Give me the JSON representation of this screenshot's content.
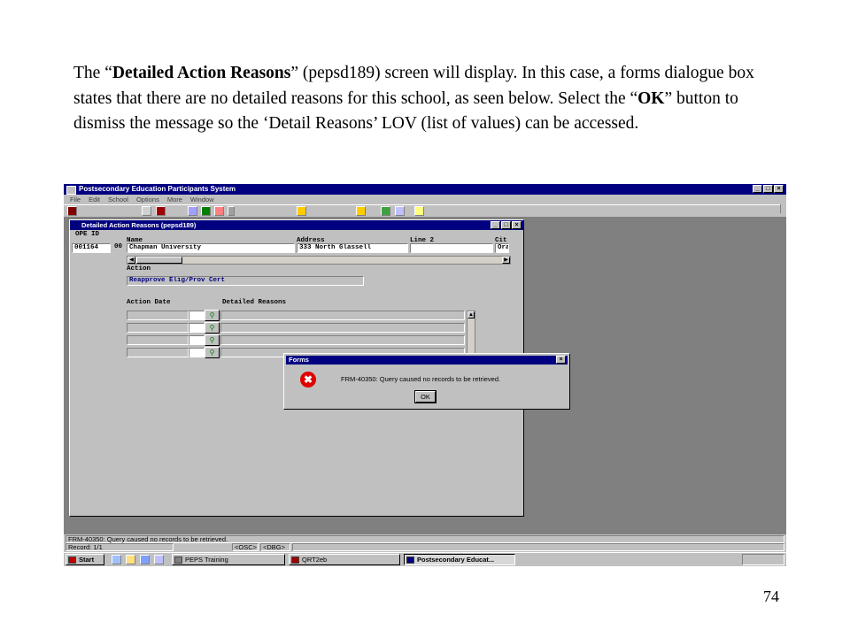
{
  "intro": {
    "t1": "The “",
    "t1_bold": "Detailed Action Reasons",
    "t2": "” (pepsd189) screen will display.  In this case, a forms dialogue box states that there are no detailed reasons for this school, as seen below.  Select the “",
    "t2_bold": "OK",
    "t3": "” button to dismiss the message so the ‘Detail Reasons’ LOV (list of values) can be accessed."
  },
  "page_number": "74",
  "app": {
    "title": "Postsecondary Education Participants System",
    "window_buttons": [
      "_",
      "□",
      "×"
    ],
    "menu": [
      "File",
      "Edit",
      "School",
      "Options",
      "More",
      "Window"
    ]
  },
  "form": {
    "title": "Detailed Action Reasons (pepsd189)",
    "labels": {
      "ope_id": "OPE ID",
      "name": "Name",
      "address": "Address",
      "line2": "Line 2",
      "city": "Cit",
      "action": "Action",
      "action_date": "Action Date",
      "detailed_reasons": "Detailed Reasons"
    },
    "values": {
      "ope_id": "001164",
      "ope_id_suffix": "00",
      "name": "Chapman University",
      "address": "333 North Glassell",
      "line2": "",
      "city": "Ora",
      "action": "Reapprove Elig/Prov Cert"
    },
    "lov_icon": "lov-lookup-icon"
  },
  "dialog": {
    "title": "Forms",
    "icon": "error-x-icon",
    "message": "FRM-40350: Query caused no records to be retrieved.",
    "ok_label": "OK"
  },
  "status": {
    "message": "FRM-40350: Query caused no records to be retrieved.",
    "record": "Record: 1/1",
    "osc": "<OSC>",
    "dbg": "<DBG>"
  },
  "taskbar": {
    "start": "Start",
    "tasks": [
      {
        "label": "PEPS Training",
        "active": false
      },
      {
        "label": "QRT2eb",
        "active": false
      },
      {
        "label": "Postsecondary Educat...",
        "active": true
      }
    ]
  }
}
